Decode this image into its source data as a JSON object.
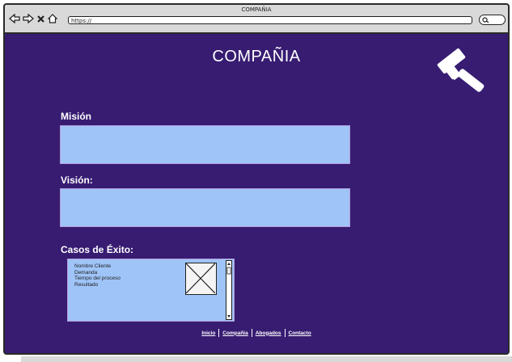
{
  "window": {
    "title": "COMPAÑIA"
  },
  "browser": {
    "url": "https://",
    "nav_icons": [
      "back-arrow-icon",
      "forward-arrow-icon",
      "close-icon",
      "home-icon"
    ],
    "search_icon": "search-icon"
  },
  "page": {
    "title": "COMPAÑIA",
    "logo_icon": "gavel-icon"
  },
  "sections": {
    "mision_label": "Misión",
    "vision_label": "Visión:",
    "casos_label": "Casos de Éxito:"
  },
  "casos": {
    "lines": [
      "Nombre Cliente",
      "Demanda",
      "Tiempo del proceso",
      "Resultado"
    ]
  },
  "footer": {
    "links": [
      "Inicio",
      "Compañia",
      "Abogados",
      "Contacto"
    ]
  },
  "colors": {
    "background": "#371c72",
    "field": "#9fc4f8",
    "chrome": "#d9d9d9"
  }
}
